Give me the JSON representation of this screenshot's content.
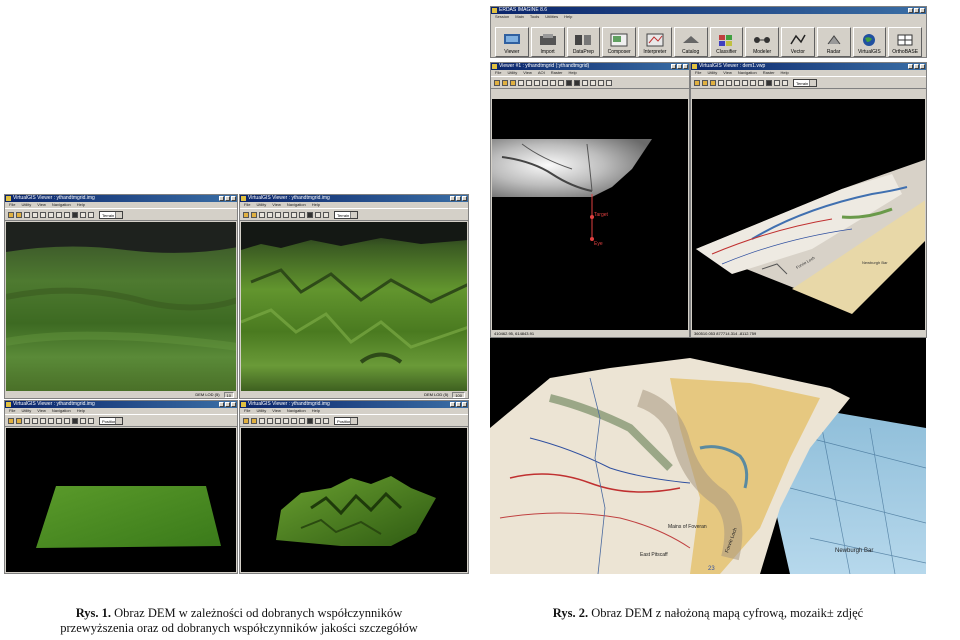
{
  "main_window": {
    "title": "ERDAS IMAGINE 8.6",
    "menu": [
      "Session",
      "Main",
      "Tools",
      "Utilities",
      "Help"
    ],
    "tools": [
      {
        "label": "Viewer",
        "icon": "viewer-icon"
      },
      {
        "label": "Import",
        "icon": "import-icon"
      },
      {
        "label": "DataPrep",
        "icon": "dataprep-icon"
      },
      {
        "label": "Composer",
        "icon": "composer-icon"
      },
      {
        "label": "Interpreter",
        "icon": "interpreter-icon"
      },
      {
        "label": "Catalog",
        "icon": "catalog-icon"
      },
      {
        "label": "Classifier",
        "icon": "classifier-icon"
      },
      {
        "label": "Modeler",
        "icon": "modeler-icon"
      },
      {
        "label": "Vector",
        "icon": "vector-icon"
      },
      {
        "label": "Radar",
        "icon": "radar-icon"
      },
      {
        "label": "VirtualGIS",
        "icon": "globe-icon"
      },
      {
        "label": "OrthoBASE",
        "icon": "orthobase-icon"
      }
    ]
  },
  "viewer2d": {
    "title": "Viewer #1 : ythandtmgrid (:ythandtmgrid)",
    "menu": [
      "File",
      "Utility",
      "View",
      "AOI",
      "Raster",
      "Help"
    ],
    "status": "410462.95, 614843.91",
    "markers": {
      "target": "Target",
      "eye": "Eye"
    }
  },
  "vgis_top_right": {
    "title": "VirtualGIS Viewer : dem1.vwp",
    "menu": [
      "File",
      "Utility",
      "View",
      "Navigation",
      "Raster",
      "Help"
    ],
    "mode": "Terrain",
    "status": "360510.053  877714.314  -8112.759",
    "map_labels": [
      "Newburgh Bar",
      "Forvie Loch"
    ]
  },
  "quad_windows": [
    {
      "title": "VirtualGIS Viewer : ythandtmgrid.img",
      "menu": [
        "File",
        "Utility",
        "View",
        "Navigation",
        "Help"
      ],
      "mode": "Terrain",
      "lod_label": "DEM LOD (5)",
      "lod_value": "10"
    },
    {
      "title": "VirtualGIS Viewer : ythandtmgrid.img",
      "menu": [
        "File",
        "Utility",
        "View",
        "Navigation",
        "Help"
      ],
      "mode": "Terrain",
      "lod_label": "DEM LOD (5)",
      "lod_value": "100"
    },
    {
      "title": "VirtualGIS Viewer : ythandtmgrid.img",
      "menu": [
        "File",
        "Utility",
        "View",
        "Navigation",
        "Help"
      ],
      "mode": "Position"
    },
    {
      "title": "VirtualGIS Viewer : ythandtmgrid.img",
      "menu": [
        "File",
        "Utility",
        "View",
        "Navigation",
        "Help"
      ],
      "mode": "Position"
    }
  ],
  "photo_labels": [
    "Newburgh Bar",
    "Mains of Foveran",
    "East Pitscaff",
    "Forvie Loch",
    "23"
  ],
  "captions": {
    "fig1_num": "Rys. 1.",
    "fig1_line1": "Obraz DEM w zależności od dobranych współczynników",
    "fig1_line2": "przewyższenia oraz od dobranych współczynników jakości szczegółów",
    "fig2_num": "Rys. 2.",
    "fig2_text": "Obraz DEM z nałożoną mapą cyfrową, mozaik± zdjęć"
  },
  "colors": {
    "titlebar": "#0a246a",
    "terrain_green": "#4a7a28",
    "water": "#a8d0e8",
    "window_face": "#d4d0c8"
  }
}
